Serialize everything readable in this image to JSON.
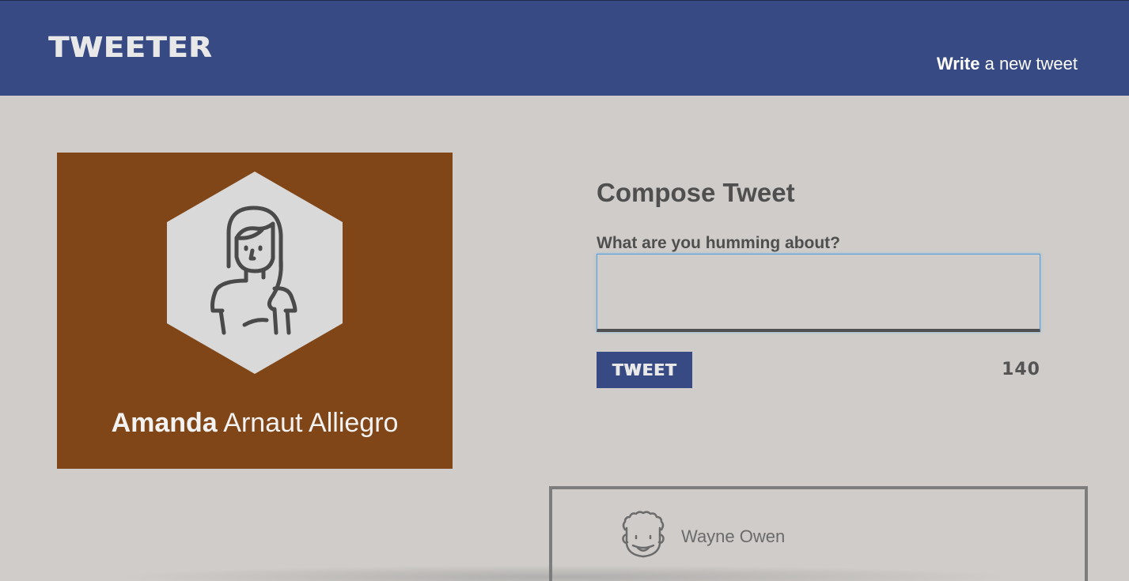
{
  "header": {
    "brand": "TWEETER",
    "compose_link_bold": "Write",
    "compose_link_rest": " a new tweet"
  },
  "profile": {
    "first_name": "Amanda",
    "last_name": " Arnaut Alliegro",
    "avatar_icon": "woman-avatar-icon",
    "background_color": "#804617"
  },
  "compose": {
    "title": "Compose Tweet",
    "label": "What are you humming about?",
    "input_value": "",
    "button_label": "TWEET",
    "counter": "140"
  },
  "tweets": [
    {
      "author": "Wayne Owen",
      "avatar_icon": "curly-hair-man-avatar-icon"
    }
  ],
  "colors": {
    "nav": "#374a83",
    "page_background": "#cfccc9",
    "text_dark": "#4f4f4f"
  }
}
